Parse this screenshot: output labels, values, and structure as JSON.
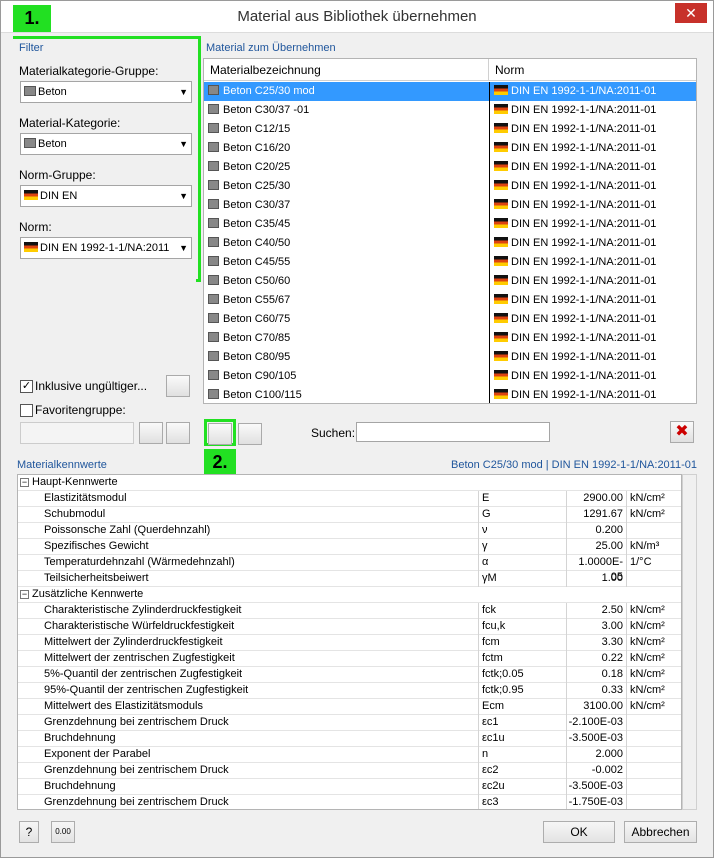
{
  "window": {
    "title": "Material aus Bibliothek übernehmen",
    "close": "✕"
  },
  "markers": {
    "one": "1.",
    "two": "2."
  },
  "filter": {
    "label": "Filter",
    "group_label": "Materialkategorie-Gruppe:",
    "group_value": "Beton",
    "category_label": "Material-Kategorie:",
    "category_value": "Beton",
    "norm_group_label": "Norm-Gruppe:",
    "norm_group_value": "DIN EN",
    "norm_label": "Norm:",
    "norm_value": "DIN EN 1992-1-1/NA:2011",
    "include_invalid": "Inklusive ungültiger...",
    "include_invalid_checked": "✓",
    "favorites": "Favoritengruppe:"
  },
  "list": {
    "label": "Material zum Übernehmen",
    "col1": "Materialbezeichnung",
    "col2": "Norm",
    "rows": [
      {
        "name": "Beton C25/30 mod",
        "norm": "DIN EN 1992-1-1/NA:2011-01"
      },
      {
        "name": "Beton C30/37 -01",
        "norm": "DIN EN 1992-1-1/NA:2011-01"
      },
      {
        "name": "Beton C12/15",
        "norm": "DIN EN 1992-1-1/NA:2011-01"
      },
      {
        "name": "Beton C16/20",
        "norm": "DIN EN 1992-1-1/NA:2011-01"
      },
      {
        "name": "Beton C20/25",
        "norm": "DIN EN 1992-1-1/NA:2011-01"
      },
      {
        "name": "Beton C25/30",
        "norm": "DIN EN 1992-1-1/NA:2011-01"
      },
      {
        "name": "Beton C30/37",
        "norm": "DIN EN 1992-1-1/NA:2011-01"
      },
      {
        "name": "Beton C35/45",
        "norm": "DIN EN 1992-1-1/NA:2011-01"
      },
      {
        "name": "Beton C40/50",
        "norm": "DIN EN 1992-1-1/NA:2011-01"
      },
      {
        "name": "Beton C45/55",
        "norm": "DIN EN 1992-1-1/NA:2011-01"
      },
      {
        "name": "Beton C50/60",
        "norm": "DIN EN 1992-1-1/NA:2011-01"
      },
      {
        "name": "Beton C55/67",
        "norm": "DIN EN 1992-1-1/NA:2011-01"
      },
      {
        "name": "Beton C60/75",
        "norm": "DIN EN 1992-1-1/NA:2011-01"
      },
      {
        "name": "Beton C70/85",
        "norm": "DIN EN 1992-1-1/NA:2011-01"
      },
      {
        "name": "Beton C80/95",
        "norm": "DIN EN 1992-1-1/NA:2011-01"
      },
      {
        "name": "Beton C90/105",
        "norm": "DIN EN 1992-1-1/NA:2011-01"
      },
      {
        "name": "Beton C100/115",
        "norm": "DIN EN 1992-1-1/NA:2011-01"
      }
    ],
    "search_label": "Suchen:",
    "search_value": ""
  },
  "props": {
    "label": "Materialkennwerte",
    "selected": "Beton C25/30 mod  |  DIN EN 1992-1-1/NA:2011-01",
    "groups": [
      {
        "name": "Haupt-Kennwerte",
        "rows": [
          {
            "name": "Elastizitätsmodul",
            "sym": "E",
            "val": "2900.00",
            "unit": "kN/cm²"
          },
          {
            "name": "Schubmodul",
            "sym": "G",
            "val": "1291.67",
            "unit": "kN/cm²"
          },
          {
            "name": "Poissonsche Zahl (Querdehnzahl)",
            "sym": "ν",
            "val": "0.200",
            "unit": ""
          },
          {
            "name": "Spezifisches Gewicht",
            "sym": "γ",
            "val": "25.00",
            "unit": "kN/m³"
          },
          {
            "name": "Temperaturdehnzahl (Wärmedehnzahl)",
            "sym": "α",
            "val": "1.0000E-05",
            "unit": "1/°C"
          },
          {
            "name": "Teilsicherheitsbeiwert",
            "sym": "γM",
            "val": "1.00",
            "unit": ""
          }
        ]
      },
      {
        "name": "Zusätzliche Kennwerte",
        "rows": [
          {
            "name": "Charakteristische Zylinderdruckfestigkeit",
            "sym": "fck",
            "val": "2.50",
            "unit": "kN/cm²"
          },
          {
            "name": "Charakteristische Würfeldruckfestigkeit",
            "sym": "fcu,k",
            "val": "3.00",
            "unit": "kN/cm²"
          },
          {
            "name": "Mittelwert der Zylinderdruckfestigkeit",
            "sym": "fcm",
            "val": "3.30",
            "unit": "kN/cm²"
          },
          {
            "name": "Mittelwert der zentrischen Zugfestigkeit",
            "sym": "fctm",
            "val": "0.22",
            "unit": "kN/cm²"
          },
          {
            "name": "5%-Quantil der zentrischen Zugfestigkeit",
            "sym": "fctk;0.05",
            "val": "0.18",
            "unit": "kN/cm²"
          },
          {
            "name": "95%-Quantil der zentrischen Zugfestigkeit",
            "sym": "fctk;0.95",
            "val": "0.33",
            "unit": "kN/cm²"
          },
          {
            "name": "Mittelwert des Elastizitätsmoduls",
            "sym": "Ecm",
            "val": "3100.00",
            "unit": "kN/cm²"
          },
          {
            "name": "Grenzdehnung bei zentrischem Druck",
            "sym": "εc1",
            "val": "-2.100E-03",
            "unit": ""
          },
          {
            "name": "Bruchdehnung",
            "sym": "εc1u",
            "val": "-3.500E-03",
            "unit": ""
          },
          {
            "name": "Exponent der Parabel",
            "sym": "n",
            "val": "2.000",
            "unit": ""
          },
          {
            "name": "Grenzdehnung bei zentrischem Druck",
            "sym": "εc2",
            "val": "-0.002",
            "unit": ""
          },
          {
            "name": "Bruchdehnung",
            "sym": "εc2u",
            "val": "-3.500E-03",
            "unit": ""
          },
          {
            "name": "Grenzdehnung bei zentrischem Druck",
            "sym": "εc3",
            "val": "-1.750E-03",
            "unit": ""
          }
        ]
      }
    ]
  },
  "footer": {
    "ok": "OK",
    "cancel": "Abbrechen",
    "units_icon": "0.00"
  }
}
